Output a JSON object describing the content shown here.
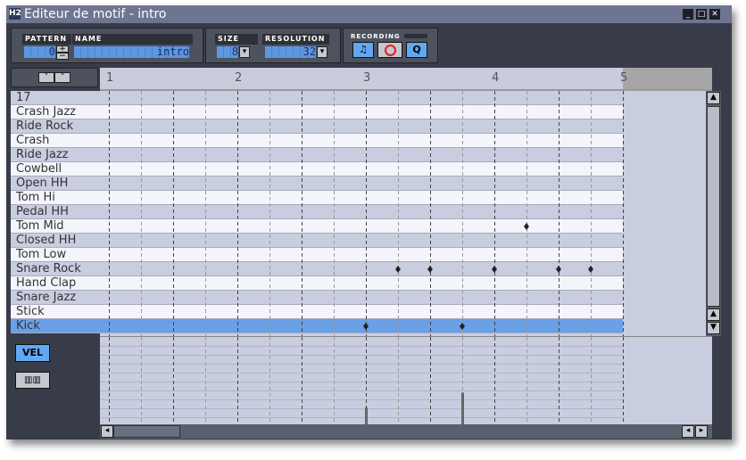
{
  "window": {
    "title": "Editeur de motif - intro",
    "logo": "H2"
  },
  "toolbar": {
    "pattern_label": "PATTERN",
    "pattern_value": "0",
    "name_label": "NAME",
    "name_value": "intro",
    "size_label": "SIZE",
    "size_value": "8",
    "resolution_label": "RESOLUTION",
    "resolution_value": "32",
    "recording_label": "RECORDING",
    "plus": "+",
    "minus": "−",
    "dropdown": "▾",
    "quantize_label": "Q"
  },
  "ruler": {
    "bars": [
      "1",
      "2",
      "3",
      "4",
      "5"
    ]
  },
  "instruments": [
    "17",
    "Crash Jazz",
    "Ride Rock",
    "Crash",
    "Ride Jazz",
    "Cowbell",
    "Open HH",
    "Tom Hi",
    "Pedal HH",
    "Tom Mid",
    "Closed HH",
    "Tom Low",
    "Snare Rock",
    "Hand Clap",
    "Snare Jazz",
    "Stick",
    "Kick"
  ],
  "selected_instrument": "Kick",
  "grid": {
    "steps_per_beat": 8,
    "beats": 4,
    "notes": [
      {
        "instrument": "Tom Mid",
        "step": 26
      },
      {
        "instrument": "Snare Rock",
        "step": 18
      },
      {
        "instrument": "Snare Rock",
        "step": 20
      },
      {
        "instrument": "Snare Rock",
        "step": 24
      },
      {
        "instrument": "Snare Rock",
        "step": 28
      },
      {
        "instrument": "Snare Rock",
        "step": 30
      },
      {
        "instrument": "Kick",
        "step": 16,
        "velocity": 0.2
      },
      {
        "instrument": "Kick",
        "step": 22,
        "velocity": 0.37
      }
    ]
  },
  "side_buttons": {
    "vel_label": "VEL"
  },
  "colors": {
    "selected_row": "#6aa0e6",
    "accent": "#62a8f0",
    "record": "#e02020"
  }
}
